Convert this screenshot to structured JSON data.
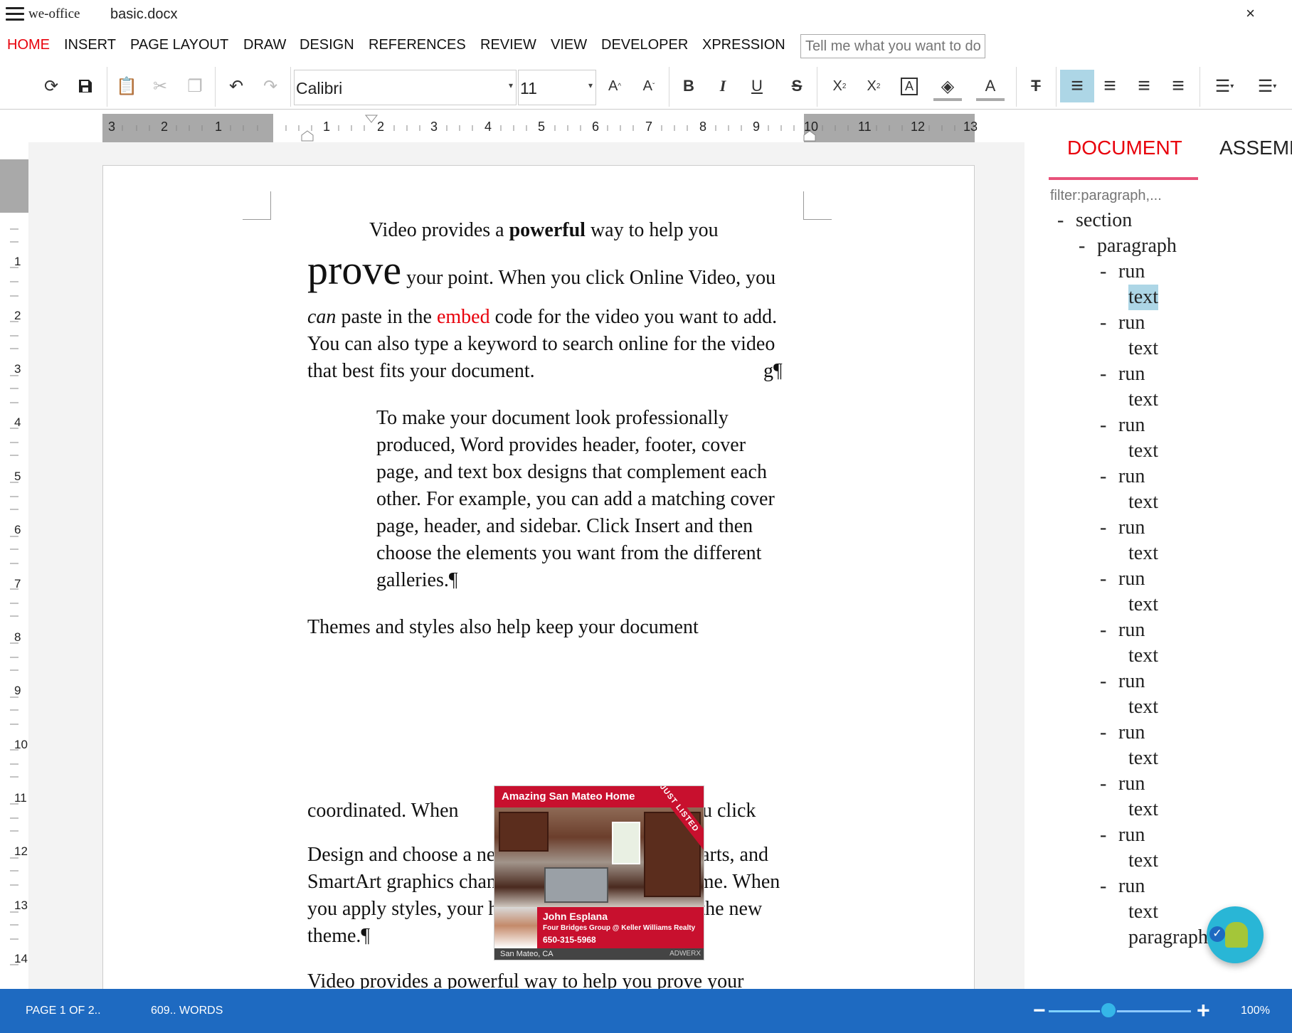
{
  "window": {
    "app_name": "we-office",
    "file_name": "basic.docx",
    "close": "×"
  },
  "menu": {
    "tabs": [
      {
        "label": "HOME",
        "active": true
      },
      {
        "label": "INSERT"
      },
      {
        "label": "PAGE LAYOUT"
      },
      {
        "label": "DRAW"
      },
      {
        "label": "DESIGN"
      },
      {
        "label": "REFERENCES"
      },
      {
        "label": "REVIEW"
      },
      {
        "label": "VIEW"
      },
      {
        "label": "DEVELOPER"
      },
      {
        "label": "XPRESSION"
      }
    ],
    "tell_me_placeholder": "Tell me what you want to do"
  },
  "toolbar": {
    "font": "Calibri",
    "size": "11",
    "glyphs": {
      "refresh": "⟳",
      "save": "💾",
      "paste": "📋",
      "cut": "✂",
      "copy": "❐",
      "undo": "↶",
      "redo": "↷",
      "grow": "A",
      "shrink": "A",
      "bold": "B",
      "italic": "I",
      "underline": "U",
      "strike": "S",
      "subscript": "X",
      "superscript": "X",
      "textbox": "A",
      "fill": "◈",
      "fontcolor": "A",
      "clear": "T",
      "align_left": "≡",
      "align_center": "≡",
      "align_right": "≡",
      "justify": "≡",
      "bullets": "☰",
      "numbering": "☰"
    },
    "highlight_color": "#aaaaaa",
    "font_color_bar": "#aaaaaa"
  },
  "ruler": {
    "h_left_numbers": [
      "3",
      "2",
      "1"
    ],
    "h_numbers": [
      "1",
      "2",
      "3",
      "4",
      "5",
      "6",
      "7",
      "8",
      "9",
      "10",
      "11",
      "12",
      "13"
    ],
    "v_numbers": [
      "1",
      "2",
      "3",
      "4",
      "5",
      "6",
      "7",
      "8",
      "9",
      "10",
      "11",
      "12",
      "13",
      "14"
    ]
  },
  "document": {
    "line1": {
      "a": "Video provides a ",
      "b": "powerful",
      "c": " way to help you"
    },
    "line2": {
      "a": "prove",
      "b": " your point. When you click Online Video, you"
    },
    "line3": {
      "a": "can",
      "b": " paste in the ",
      "c": "embed",
      "d": " code for the video you want to add."
    },
    "line4": "You can also type a keyword to search online for the video",
    "line5": "that best fits your document.",
    "line5_end": "g¶",
    "indented": [
      "To make your document look professionally",
      "produced, Word provides header, footer, cover",
      "page, and text box designs that complement each",
      "other. For example, you can add a matching cover",
      "page, header, and sidebar. Click Insert and then",
      "choose the elements you want from the different",
      "galleries.¶"
    ],
    "themes_line": "Themes and styles also help keep your document",
    "coord_left": "coordinated. When",
    "coord_right": "you click",
    "design_lines": [
      "Design and choose a new Theme, the pictures, charts, and",
      "SmartArt graphics change to match your new theme. When",
      "you apply styles, your headings change to match the new",
      "theme.¶"
    ],
    "last_line": "Video provides a powerful way to help you prove your"
  },
  "ad": {
    "headline": "Amazing San Mateo Home",
    "ribbon": "JUST LISTED",
    "agent": "John Esplana",
    "company": "Four Bridges Group @ Keller Williams Realty",
    "phone": "650-315-5968",
    "location": "San Mateo, CA",
    "brand": "ADWERX"
  },
  "panel": {
    "tabs": [
      {
        "label": "DOCUMENT",
        "active": true
      },
      {
        "label": "ASSEMBLE"
      }
    ],
    "filter_placeholder": "filter:paragraph,...",
    "tree": [
      {
        "label": "section",
        "level": 0,
        "dash": true
      },
      {
        "label": "paragraph",
        "level": 1,
        "dash": true
      },
      {
        "label": "run",
        "level": 2,
        "dash": true
      },
      {
        "label": "text",
        "level": 3,
        "selected": true
      },
      {
        "label": "run",
        "level": 2,
        "dash": true
      },
      {
        "label": "text",
        "level": 3
      },
      {
        "label": "run",
        "level": 2,
        "dash": true
      },
      {
        "label": "text",
        "level": 3
      },
      {
        "label": "run",
        "level": 2,
        "dash": true
      },
      {
        "label": "text",
        "level": 3
      },
      {
        "label": "run",
        "level": 2,
        "dash": true
      },
      {
        "label": "text",
        "level": 3
      },
      {
        "label": "run",
        "level": 2,
        "dash": true
      },
      {
        "label": "text",
        "level": 3
      },
      {
        "label": "run",
        "level": 2,
        "dash": true
      },
      {
        "label": "text",
        "level": 3
      },
      {
        "label": "run",
        "level": 2,
        "dash": true
      },
      {
        "label": "text",
        "level": 3
      },
      {
        "label": "run",
        "level": 2,
        "dash": true
      },
      {
        "label": "text",
        "level": 3
      },
      {
        "label": "run",
        "level": 2,
        "dash": true
      },
      {
        "label": "text",
        "level": 3
      },
      {
        "label": "run",
        "level": 2,
        "dash": true
      },
      {
        "label": "text",
        "level": 3
      },
      {
        "label": "run",
        "level": 2,
        "dash": true
      },
      {
        "label": "text",
        "level": 3
      },
      {
        "label": "run",
        "level": 2,
        "dash": true
      },
      {
        "label": "text",
        "level": 3
      },
      {
        "label": "paragraph",
        "level": 3
      }
    ]
  },
  "status": {
    "page": "PAGE 1 OF 2..",
    "words": "609.. WORDS",
    "zoom": "100%",
    "zoom_level": 0.42,
    "minus": "−",
    "plus": "+"
  },
  "fab": {
    "check": "✓"
  },
  "colors": {
    "accent": "#e8000b",
    "status_bar": "#1e6ac1",
    "selection": "#add6e6"
  }
}
